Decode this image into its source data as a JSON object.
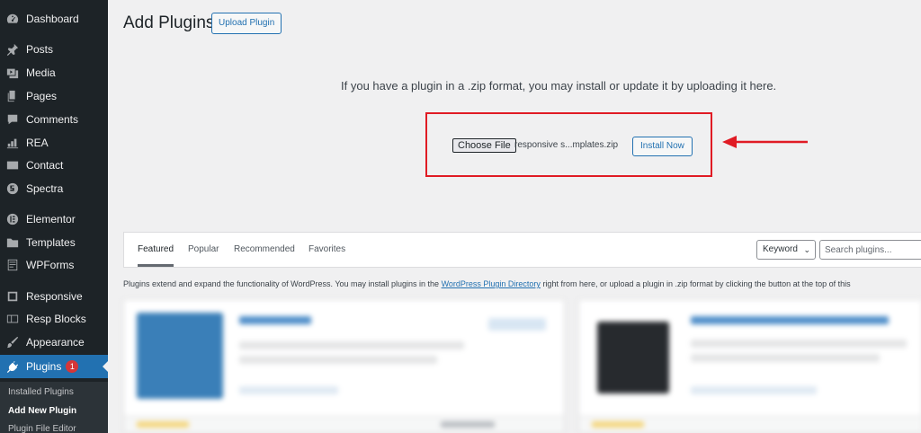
{
  "sidebar": {
    "items": [
      {
        "label": "Dashboard",
        "icon": "dashboard-icon"
      },
      {
        "label": "Posts",
        "icon": "pin-icon"
      },
      {
        "label": "Media",
        "icon": "media-icon"
      },
      {
        "label": "Pages",
        "icon": "pages-icon"
      },
      {
        "label": "Comments",
        "icon": "comment-icon"
      },
      {
        "label": "REA",
        "icon": "chart-icon"
      },
      {
        "label": "Contact",
        "icon": "mail-icon"
      },
      {
        "label": "Spectra",
        "icon": "spectra-icon"
      },
      {
        "label": "Elementor",
        "icon": "elementor-icon"
      },
      {
        "label": "Templates",
        "icon": "folder-icon"
      },
      {
        "label": "WPForms",
        "icon": "forms-icon"
      },
      {
        "label": "Responsive",
        "icon": "responsive-icon"
      },
      {
        "label": "Resp Blocks",
        "icon": "blocks-icon"
      },
      {
        "label": "Appearance",
        "icon": "brush-icon"
      },
      {
        "label": "Plugins",
        "icon": "plugin-icon",
        "badge": "1"
      }
    ],
    "submenu": [
      {
        "label": "Installed Plugins"
      },
      {
        "label": "Add New Plugin"
      },
      {
        "label": "Plugin File Editor"
      }
    ]
  },
  "header": {
    "title": "Add Plugins",
    "upload_button": "Upload Plugin"
  },
  "upload": {
    "description": "If you have a plugin in a .zip format, you may install or update it by uploading it here.",
    "choose_file": "Choose File",
    "file_name": "responsive s...mplates.zip",
    "install_button": "Install Now"
  },
  "filter": {
    "tabs": [
      "Featured",
      "Popular",
      "Recommended",
      "Favorites"
    ],
    "keyword_select": "Keyword",
    "search_placeholder": "Search plugins..."
  },
  "intro": {
    "before": "Plugins extend and expand the functionality of WordPress. You may install plugins in the ",
    "link": "WordPress Plugin Directory",
    "after": " right from here, or upload a plugin in .zip format by clicking the button at the top of this"
  },
  "colors": {
    "sidebar_bg": "#1d2327",
    "accent": "#2271b1",
    "highlight_red": "#e01b24"
  }
}
